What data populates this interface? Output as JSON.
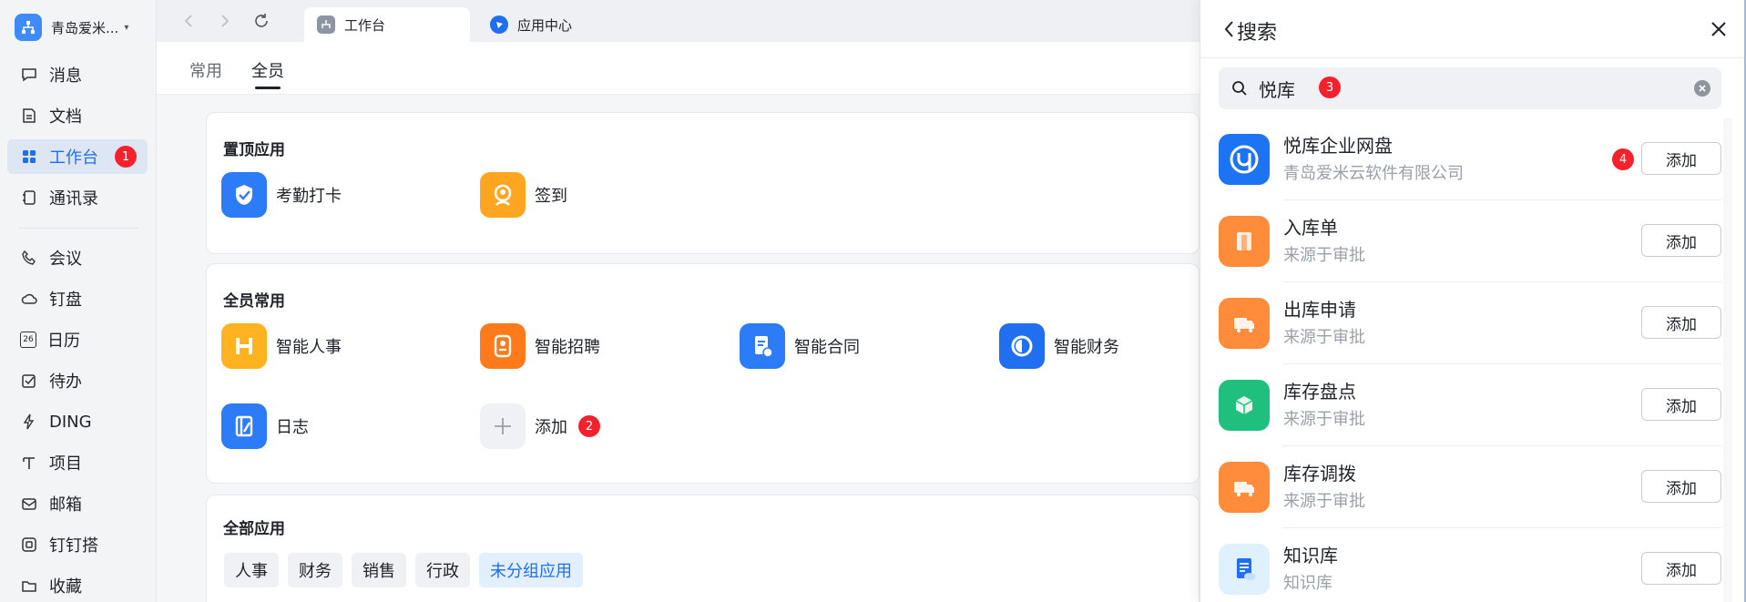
{
  "org": {
    "name": "青岛爱米...",
    "caret": "▾"
  },
  "sidebar": {
    "items": [
      {
        "label": "消息",
        "icon": "message-icon"
      },
      {
        "label": "文档",
        "icon": "document-icon"
      },
      {
        "label": "工作台",
        "icon": "workbench-icon",
        "active": true,
        "badge": "1"
      },
      {
        "label": "通讯录",
        "icon": "contacts-icon"
      },
      {
        "label": "会议",
        "icon": "meeting-icon"
      },
      {
        "label": "钉盘",
        "icon": "cloud-disk-icon"
      },
      {
        "label": "日历",
        "icon": "calendar-icon",
        "glyph": "26"
      },
      {
        "label": "待办",
        "icon": "todo-icon"
      },
      {
        "label": "DING",
        "icon": "ding-icon"
      },
      {
        "label": "项目",
        "icon": "project-icon"
      },
      {
        "label": "邮箱",
        "icon": "mail-icon"
      },
      {
        "label": "钉钉搭",
        "icon": "builder-icon"
      },
      {
        "label": "收藏",
        "icon": "favorites-icon"
      }
    ]
  },
  "tabs": [
    {
      "label": "工作台",
      "active": true
    },
    {
      "label": "应用中心",
      "active": false
    }
  ],
  "subtabs": {
    "common": "常用",
    "all_staff": "全员"
  },
  "pinned": {
    "title": "置顶应用",
    "apps": [
      {
        "label": "考勤打卡",
        "color": "#2b7cf6"
      },
      {
        "label": "签到",
        "color": "#ffa51f"
      }
    ]
  },
  "common_apps": {
    "title": "全员常用",
    "apps": [
      {
        "label": "智能人事",
        "color": "#ffb320"
      },
      {
        "label": "智能招聘",
        "color": "#ff7a1a"
      },
      {
        "label": "智能合同",
        "color": "#2b7cf6"
      },
      {
        "label": "智能财务",
        "color": "#1f6ff0"
      },
      {
        "label": "日志",
        "color": "#2b7cf6"
      },
      {
        "label": "添加",
        "color": "#f0f1f4",
        "badge": "2"
      }
    ]
  },
  "all_apps": {
    "title": "全部应用",
    "chips": [
      "人事",
      "财务",
      "销售",
      "行政",
      "未分组应用"
    ]
  },
  "search_panel": {
    "title": "搜索",
    "query": "悦库",
    "query_badge": "3",
    "results": [
      {
        "name": "悦库企业网盘",
        "sub": "青岛爱米云软件有限公司",
        "button": "添加",
        "color": "#1c74f2",
        "badge": "4"
      },
      {
        "name": "入库单",
        "sub": "来源于审批",
        "button": "添加",
        "color": "#ff8c3a"
      },
      {
        "name": "出库申请",
        "sub": "来源于审批",
        "button": "添加",
        "color": "#ff8c3a"
      },
      {
        "name": "库存盘点",
        "sub": "来源于审批",
        "button": "添加",
        "color": "#1fbf7e"
      },
      {
        "name": "库存调拨",
        "sub": "来源于审批",
        "button": "添加",
        "color": "#ff8c3a"
      },
      {
        "name": "知识库",
        "sub": "知识库",
        "button": "添加",
        "color": "#dff0ff"
      }
    ]
  }
}
